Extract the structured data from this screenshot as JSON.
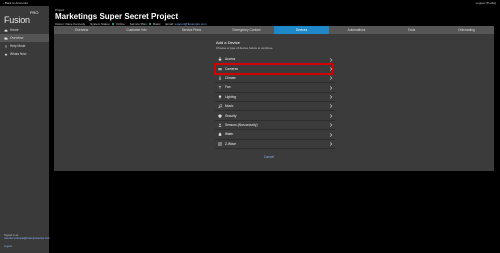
{
  "topbar": {
    "back_link": "‹ Back to Accounts",
    "logged_in": "Logout (TLabs)"
  },
  "brand": {
    "logo_text": "Fusion",
    "logo_suffix": "PRO"
  },
  "sidebar": {
    "items": [
      {
        "label": "Home",
        "icon": "home-icon"
      },
      {
        "label": "Overview",
        "icon": "folder-icon",
        "active": true
      },
      {
        "label": "Help Mode",
        "icon": "info-icon"
      },
      {
        "label": "Whats New",
        "icon": "star-icon"
      }
    ],
    "footer_line1": "Signed in as",
    "footer_line2": "member.example@fusionproserver.com",
    "logout": "Logout"
  },
  "project": {
    "label": "Project",
    "title": "Marketings Super Secret Project",
    "meta_owner": "Owner: Dave Kennedy",
    "meta_status_label": "System Status:",
    "meta_status_value": "Online",
    "meta_plan_label": "Service Plan:",
    "meta_plan_value": "Basic",
    "meta_email_label": "Email:",
    "meta_email_value": "support@fusionpro.com"
  },
  "tabs": [
    {
      "label": "Overview"
    },
    {
      "label": "Customer Info"
    },
    {
      "label": "Service Plans"
    },
    {
      "label": "Emergency Contact"
    },
    {
      "label": "Devices",
      "active": true
    },
    {
      "label": "Automations"
    },
    {
      "label": "Tools"
    },
    {
      "label": "Onboarding"
    }
  ],
  "devices_panel": {
    "title": "Add a Device",
    "subtitle": "Choose a type of device below to continue.",
    "items": [
      {
        "label": "Access",
        "icon": "lock-icon"
      },
      {
        "label": "Cameras",
        "icon": "camera-icon"
      },
      {
        "label": "Climate",
        "icon": "thermometer-icon"
      },
      {
        "label": "Fan",
        "icon": "fan-icon"
      },
      {
        "label": "Lighting",
        "icon": "lightbulb-icon"
      },
      {
        "label": "Music",
        "icon": "music-icon"
      },
      {
        "label": "Security",
        "icon": "shield-icon"
      },
      {
        "label": "Sensors (Non-security)",
        "icon": "sensor-icon"
      },
      {
        "label": "Water",
        "icon": "water-drop-icon"
      },
      {
        "label": "Z-Wave",
        "icon": "zwave-icon"
      }
    ],
    "cancel": "Cancel"
  },
  "colors": {
    "accent": "#1e88c8",
    "highlight": "#d40000",
    "status_online": "#2ecc71",
    "link": "#8ab4f8"
  }
}
